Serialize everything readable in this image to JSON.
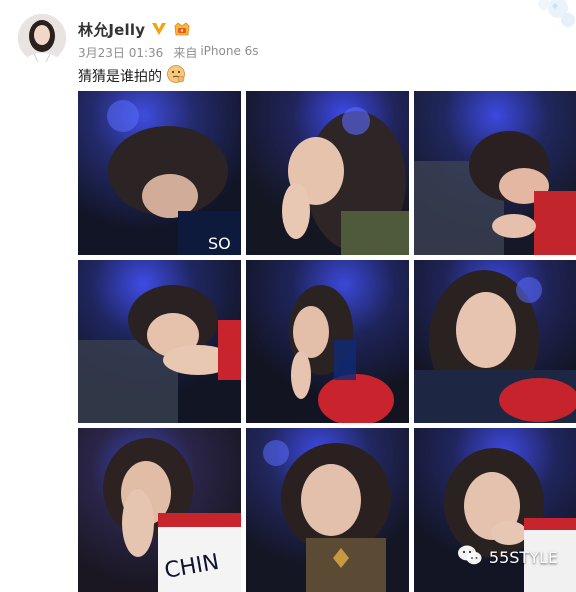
{
  "post": {
    "username": "林允Jelly",
    "verified_icon": "verified-v-icon",
    "membership_icon": "member-badge-icon",
    "date": "3月23日 01:36",
    "source_prefix": "来自",
    "source_device": "iPhone 6s",
    "caption": "猜猜是谁拍的",
    "caption_emoji": "thinking-face-emoji",
    "photo_count": 9
  },
  "watermark": {
    "text": "55STYLE",
    "icon": "wechat-icon"
  }
}
